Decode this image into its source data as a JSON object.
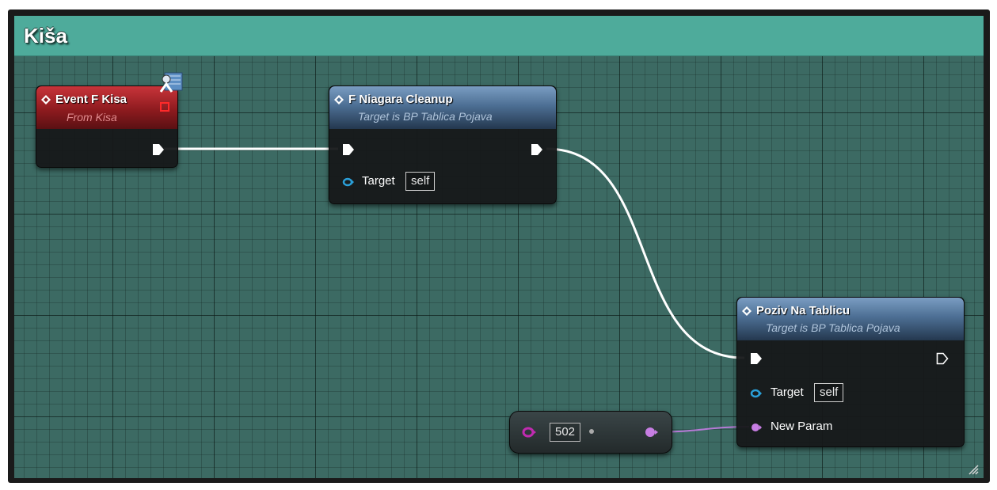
{
  "comment": {
    "title": "Kiša"
  },
  "nodes": {
    "event": {
      "title": "Event F Kisa",
      "subtitle": "From Kisa"
    },
    "niagara_cleanup": {
      "title": "F Niagara Cleanup",
      "subtitle": "Target is BP Tablica Pojava",
      "target_label": "Target",
      "target_value": "self"
    },
    "poziv": {
      "title": "Poziv Na Tablicu",
      "subtitle": "Target is BP Tablica Pojava",
      "target_label": "Target",
      "target_value": "self",
      "param_label": "New Param"
    },
    "literal": {
      "value": "502"
    }
  },
  "colors": {
    "comment_header": "#4eab9b",
    "event_header": "#8e1b1f",
    "function_header": "#4d6f94",
    "exec_wire": "#ffffff",
    "object_pin": "#2a9fd8",
    "int_pin": "#c77ee3",
    "int_pin_magenta": "#c02bb0"
  },
  "icons": [
    "function-diamond-icon",
    "replicated-network-icon",
    "event-red-square-icon",
    "resize-grip-icon"
  ]
}
